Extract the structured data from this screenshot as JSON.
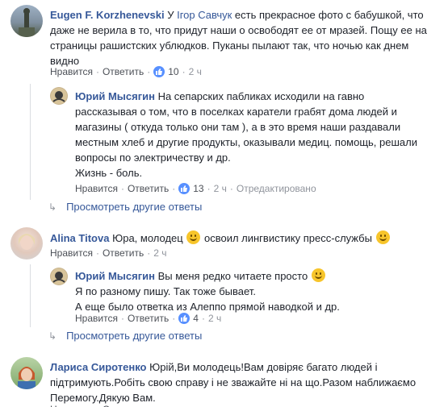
{
  "actions": {
    "like": "Нравится",
    "reply": "Ответить",
    "dot": "·"
  },
  "show_more_replies": "Просмотреть другие ответы",
  "c1": {
    "author": "Eugen F. Korzhenevski",
    "mention": "Ігор Савчук",
    "text_pre": "У",
    "text": "есть прекрасное фото с бабушкой, что даже не верила в то, что придут наши о освободят ее от мразей. Пощу ее на страницы рашистских ублюдков. Пуканы пылают так, что ночью как днем видно",
    "likes": "10",
    "time": "2 ч"
  },
  "r1": {
    "author": "Юрий Мысягин",
    "text": "На сепарских пабликах исходили на гавно рассказывая о том, что в поселках каратели грабят дома людей и магазины ( откуда только они там ), а в это время наши раздавали местным хлеб и другие продукты, оказывали медиц. помощь, решали вопросы по электричеству и др.",
    "text2": "Жизнь - боль.",
    "likes": "13",
    "time": "2 ч",
    "edited": "Отредактировано"
  },
  "c2": {
    "author": "Alina Titova",
    "text_a": "Юра, молодец",
    "text_b": "освоил лингвистику пресс-службы",
    "time": "2 ч"
  },
  "r2": {
    "author": "Юрий Мысягин",
    "line1": "Вы меня редко читаете просто",
    "line2": "Я по разному пишу. Так тоже бывает.",
    "line3": "А еще было ответка из Алеппо прямой наводкой и др.",
    "likes": "4",
    "time": "2 ч"
  },
  "c3": {
    "author": "Лариса Сиротенко",
    "text": "Юрій,Ви молодець!Вам довіряє багато людей і підтримують.Робіть свою справу і не зважайте ні на що.Разом наближаємо Перемогу.Дякую Вам."
  }
}
